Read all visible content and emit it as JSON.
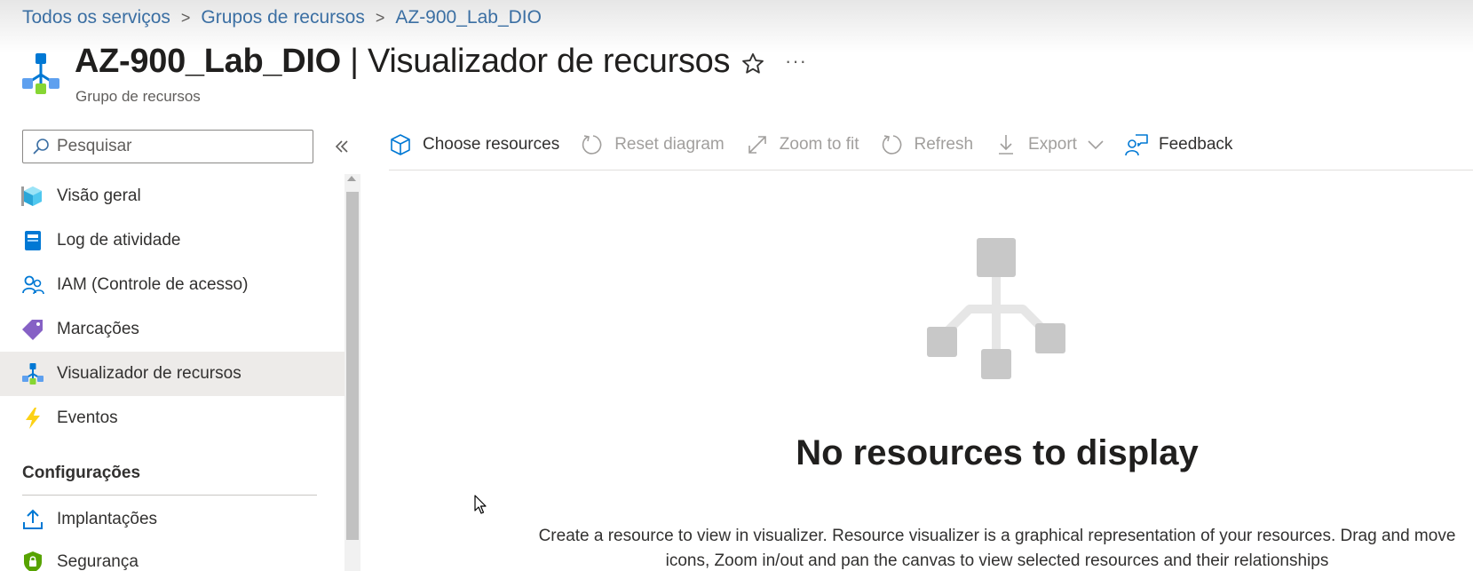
{
  "breadcrumb": {
    "items": [
      "Todos os serviços",
      "Grupos de recursos",
      "AZ-900_Lab_DIO"
    ],
    "separator": ">"
  },
  "header": {
    "title_main": "AZ-900_Lab_DIO",
    "title_rest": " | Visualizador de recursos",
    "subtitle": "Grupo de recursos",
    "icon": "resource-visualizer-icon",
    "more": "···"
  },
  "sidebar": {
    "search_placeholder": "Pesquisar",
    "items": [
      {
        "label": "Visão geral",
        "icon": "overview-cube-icon"
      },
      {
        "label": "Log de atividade",
        "icon": "activity-log-icon"
      },
      {
        "label": "IAM (Controle de acesso)",
        "icon": "people-icon"
      },
      {
        "label": "Marcações",
        "icon": "tag-icon"
      },
      {
        "label": "Visualizador de recursos",
        "icon": "resource-visualizer-icon",
        "selected": true
      },
      {
        "label": "Eventos",
        "icon": "lightning-icon"
      }
    ],
    "section_header": "Configurações",
    "section_items": [
      {
        "label": "Implantações",
        "icon": "upload-icon"
      },
      {
        "label": "Segurança",
        "icon": "shield-icon"
      }
    ]
  },
  "toolbar": {
    "choose_resources": "Choose resources",
    "reset_diagram": "Reset diagram",
    "zoom_to_fit": "Zoom to fit",
    "refresh": "Refresh",
    "export": "Export",
    "feedback": "Feedback"
  },
  "main": {
    "empty_title": "No resources to display",
    "empty_description": "Create a resource to view in visualizer. Resource visualizer is a graphical representation of your resources. Drag and move icons, Zoom in/out and pan the canvas to view selected resources and their relationships"
  },
  "colors": {
    "link": "#3b6fa3",
    "selected_bg": "#edebe9",
    "azure_blue": "#0078d4",
    "disabled_text": "#a19f9d"
  }
}
